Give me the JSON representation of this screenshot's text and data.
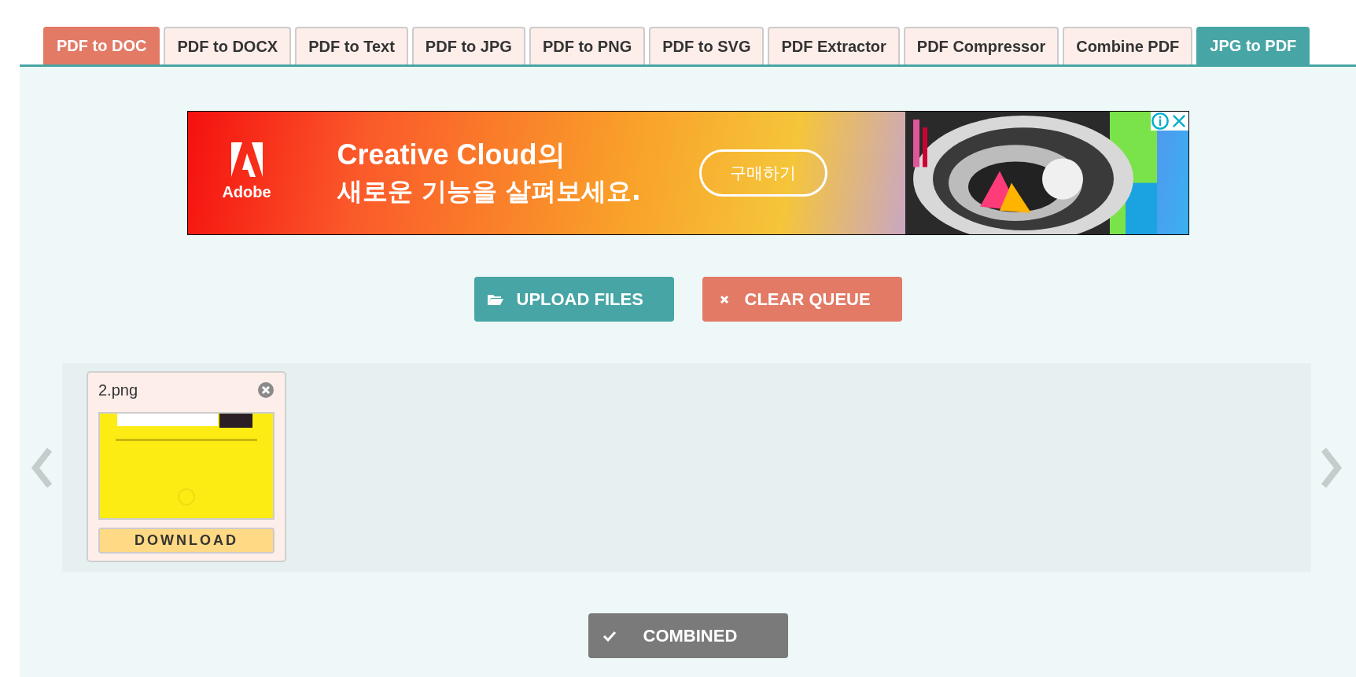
{
  "tabs": [
    {
      "label": "PDF to DOC",
      "kind": "promo",
      "selected": false
    },
    {
      "label": "PDF to DOCX",
      "kind": "plain",
      "selected": false
    },
    {
      "label": "PDF to Text",
      "kind": "plain",
      "selected": false
    },
    {
      "label": "PDF to JPG",
      "kind": "plain",
      "selected": false
    },
    {
      "label": "PDF to PNG",
      "kind": "plain",
      "selected": false
    },
    {
      "label": "PDF to SVG",
      "kind": "plain",
      "selected": false
    },
    {
      "label": "PDF Extractor",
      "kind": "plain",
      "selected": false
    },
    {
      "label": "PDF Compressor",
      "kind": "plain",
      "selected": false
    },
    {
      "label": "Combine PDF",
      "kind": "plain",
      "selected": false
    },
    {
      "label": "JPG to PDF",
      "kind": "plain",
      "selected": true
    }
  ],
  "ad": {
    "brand": "Adobe",
    "headline_1": "Creative Cloud의",
    "headline_2": "새로운 기능을 살펴보세요.",
    "cta": "구매하기"
  },
  "actions": {
    "upload": "UPLOAD FILES",
    "clear": "CLEAR QUEUE"
  },
  "queue": {
    "files": [
      {
        "name": "2.png",
        "action": "DOWNLOAD"
      }
    ]
  },
  "combine": {
    "label": "COMBINED",
    "done": true
  }
}
